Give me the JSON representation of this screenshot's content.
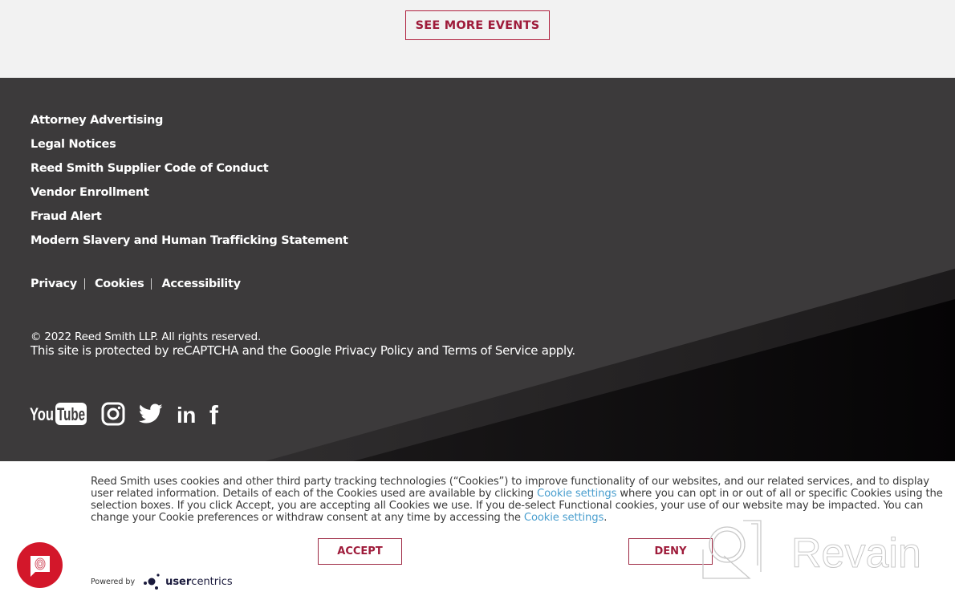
{
  "events": {
    "see_more_label": "SEE MORE EVENTS"
  },
  "footer": {
    "links": [
      {
        "label": "Attorney Advertising"
      },
      {
        "label": "Legal Notices"
      },
      {
        "label": "Reed Smith Supplier Code of Conduct"
      },
      {
        "label": "Vendor Enrollment"
      },
      {
        "label": "Fraud Alert"
      },
      {
        "label": "Modern Slavery and Human Trafficking Statement"
      }
    ],
    "policy_links": [
      {
        "label": "Privacy"
      },
      {
        "label": "Cookies"
      },
      {
        "label": "Accessibility"
      }
    ],
    "copyright": "© 2022 Reed Smith LLP. All rights reserved.",
    "recaptcha": "This site is protected by reCAPTCHA and the Google Privacy Policy and Terms of Service apply.",
    "social": [
      {
        "name": "youtube",
        "icon": "youtube-icon"
      },
      {
        "name": "instagram",
        "icon": "instagram-icon"
      },
      {
        "name": "twitter",
        "icon": "twitter-icon"
      },
      {
        "name": "linkedin",
        "icon": "linkedin-icon"
      },
      {
        "name": "facebook",
        "icon": "facebook-icon"
      }
    ],
    "youtube_text_a": "You",
    "youtube_text_b": "Tube",
    "linkedin_text": "in",
    "facebook_text": "f"
  },
  "cookie_banner": {
    "text_part1": "Reed Smith uses cookies and other third party tracking technologies (“Cookies”) to improve functionality of our websites, and our related services, and to display user related information. Details of each of the Cookies used are available by clicking ",
    "link1": "Cookie settings",
    "text_part2": " where you can opt in or out of all or specific Cookies using the selection boxes. If you click Accept, you are accepting all Cookies we use. If you de-select Functional cookies, your use of our website may be impacted. You can change your Cookie preferences or withdraw consent at any time by accessing the ",
    "link2": "Cookie settings",
    "text_part3": ".",
    "accept_label": "ACCEPT",
    "deny_label": "DENY",
    "powered_by": "Powered by",
    "brand_bold": "user",
    "brand_rest": "centrics"
  },
  "watermark": {
    "text": "Revain"
  },
  "colors": {
    "accent": "#9e1b3a",
    "footer_bg": "#3c3a3b",
    "link_blue": "#4b9fcf",
    "fab_red": "#d3172a"
  }
}
